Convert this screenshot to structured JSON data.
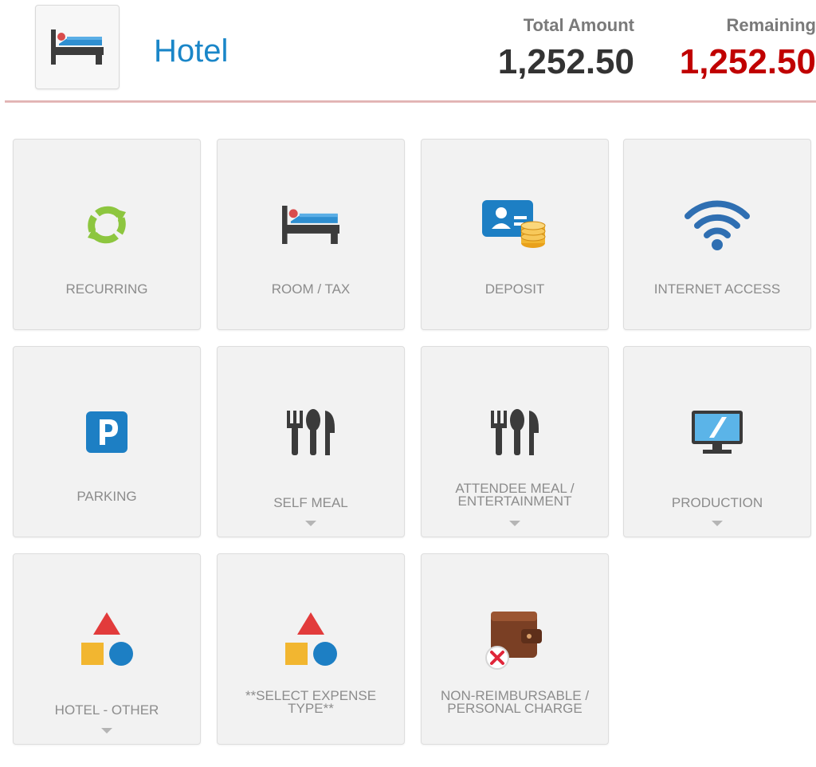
{
  "header": {
    "title": "Hotel",
    "icon": "bed-icon",
    "total_label": "Total Amount",
    "total_value": "1,252.50",
    "remaining_label": "Remaining",
    "remaining_value": "1,252.50"
  },
  "colors": {
    "title_blue": "#1a86c8",
    "remaining_red": "#c00000",
    "tile_bg": "#f2f2f2",
    "label_gray": "#8c8c8c"
  },
  "tiles": [
    {
      "label": "RECURRING",
      "icon": "recurring-icon",
      "has_dropdown": false
    },
    {
      "label": "ROOM / TAX",
      "icon": "bed-icon",
      "has_dropdown": false
    },
    {
      "label": "DEPOSIT",
      "icon": "deposit-icon",
      "has_dropdown": false
    },
    {
      "label": "INTERNET ACCESS",
      "icon": "wifi-icon",
      "has_dropdown": false
    },
    {
      "label": "PARKING",
      "icon": "parking-icon",
      "has_dropdown": false
    },
    {
      "label": "SELF MEAL",
      "icon": "utensils-icon",
      "has_dropdown": true
    },
    {
      "label": "ATTENDEE MEAL / ENTERTAINMENT",
      "icon": "utensils-icon",
      "has_dropdown": true
    },
    {
      "label": "PRODUCTION",
      "icon": "monitor-icon",
      "has_dropdown": true
    },
    {
      "label": "HOTEL - OTHER",
      "icon": "shapes-icon",
      "has_dropdown": true
    },
    {
      "label": "**SELECT EXPENSE TYPE**",
      "icon": "shapes-icon",
      "has_dropdown": false
    },
    {
      "label": "NON-REIMBURSABLE / PERSONAL CHARGE",
      "icon": "wallet-icon",
      "has_dropdown": false
    }
  ]
}
